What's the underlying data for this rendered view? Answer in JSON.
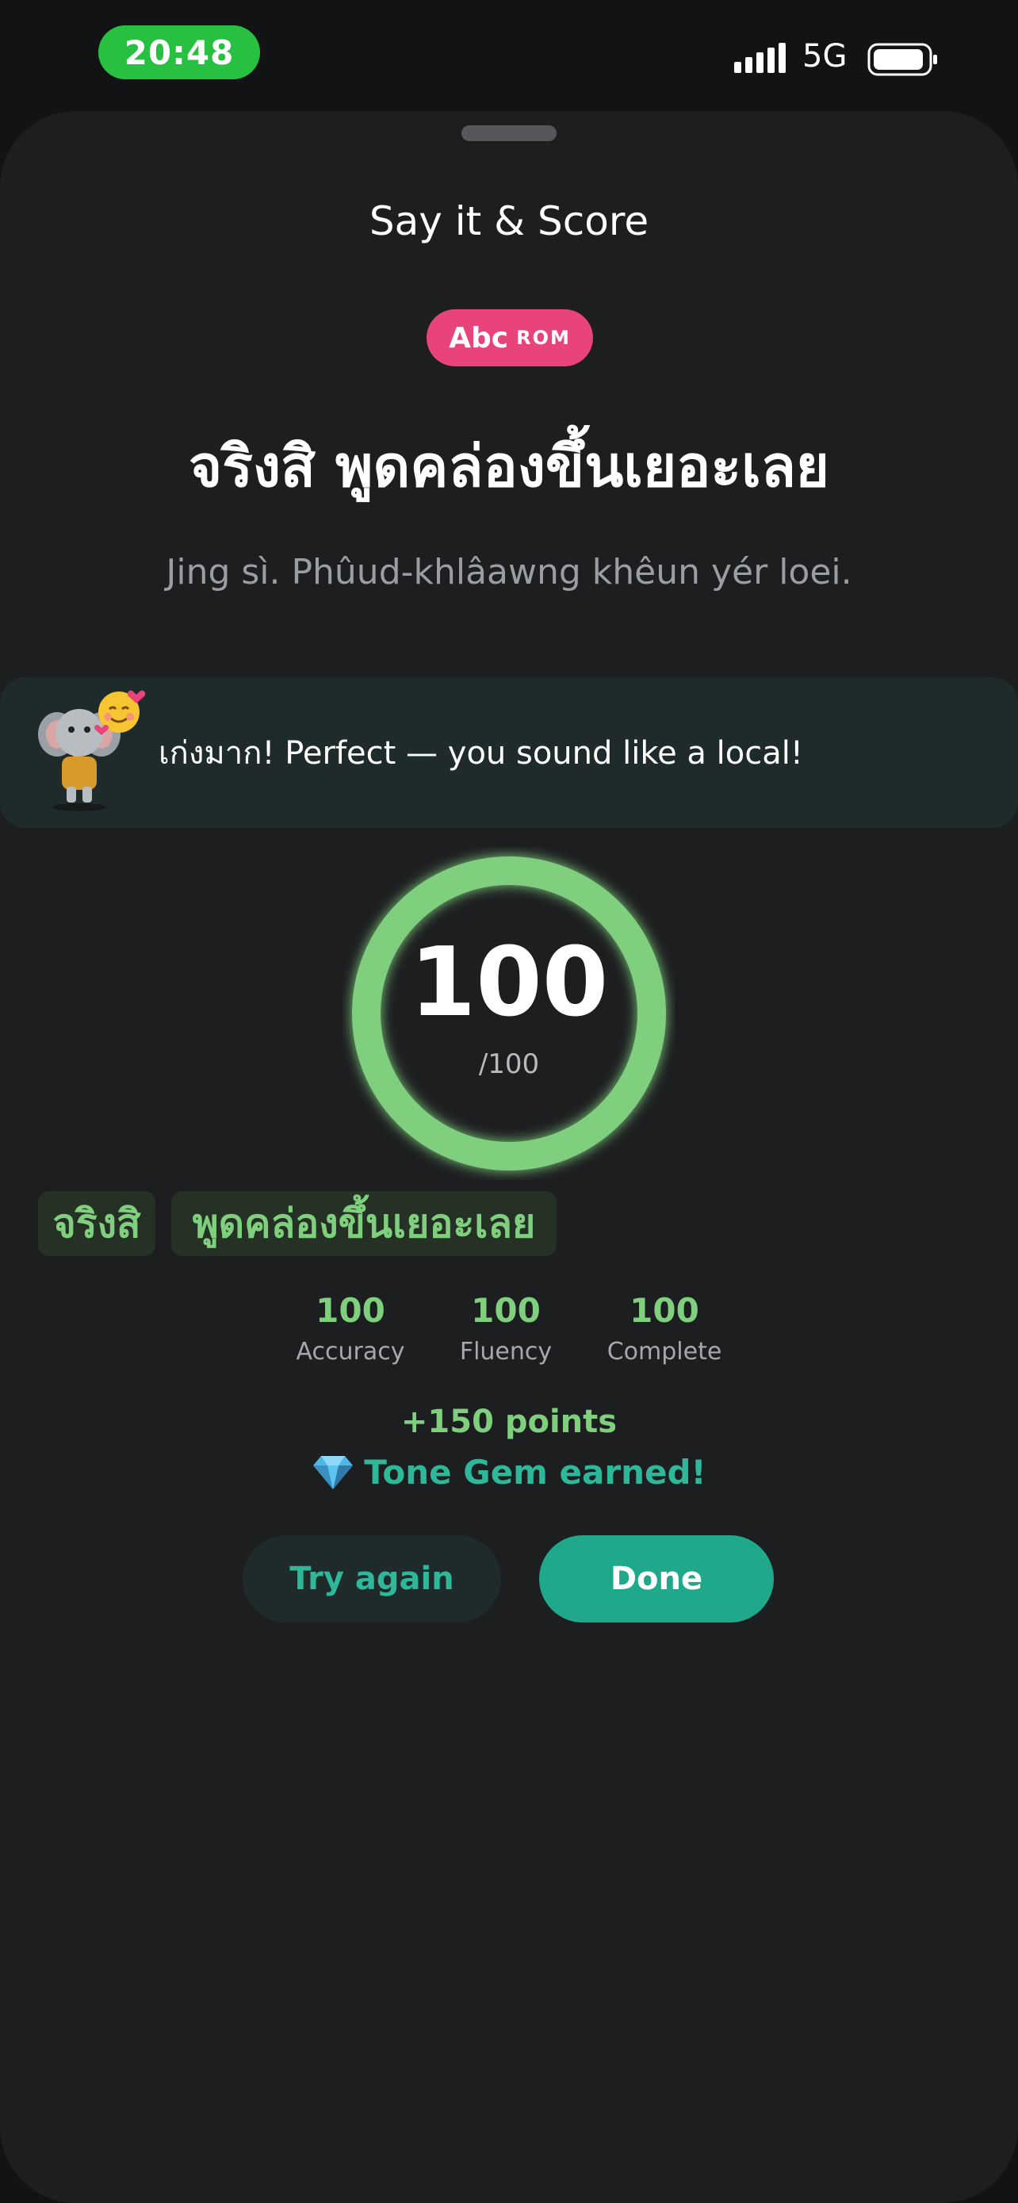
{
  "status_bar": {
    "time": "20:48",
    "network": "5G"
  },
  "sheet": {
    "title": "Say it & Score",
    "rom_toggle": {
      "abc": "Abc",
      "rom": "ROM"
    },
    "phrase_thai": "จริงสิ พูดคล่องขึ้นเยอะเลย",
    "phrase_romanized": "Jing sì. Phûud-khlâawng khêun yér loei."
  },
  "feedback": {
    "message": "เก่งมาก! Perfect — you sound like a local!"
  },
  "score": {
    "value": "100",
    "max_label": "/100",
    "fraction": 1.0
  },
  "words": [
    {
      "text": "จริงสิ"
    },
    {
      "text": "พูดคล่องขึ้นเยอะเลย"
    }
  ],
  "metrics": [
    {
      "value": "100",
      "label": "Accuracy"
    },
    {
      "value": "100",
      "label": "Fluency"
    },
    {
      "value": "100",
      "label": "Complete"
    }
  ],
  "rewards": {
    "points": "+150 points",
    "gem": "Tone Gem earned!"
  },
  "buttons": {
    "try_again": "Try again",
    "done": "Done"
  },
  "colors": {
    "accent_green": "#7fcf7f",
    "accent_teal": "#20a88a",
    "rom_pink": "#e8437a",
    "status_green": "#28c040"
  }
}
